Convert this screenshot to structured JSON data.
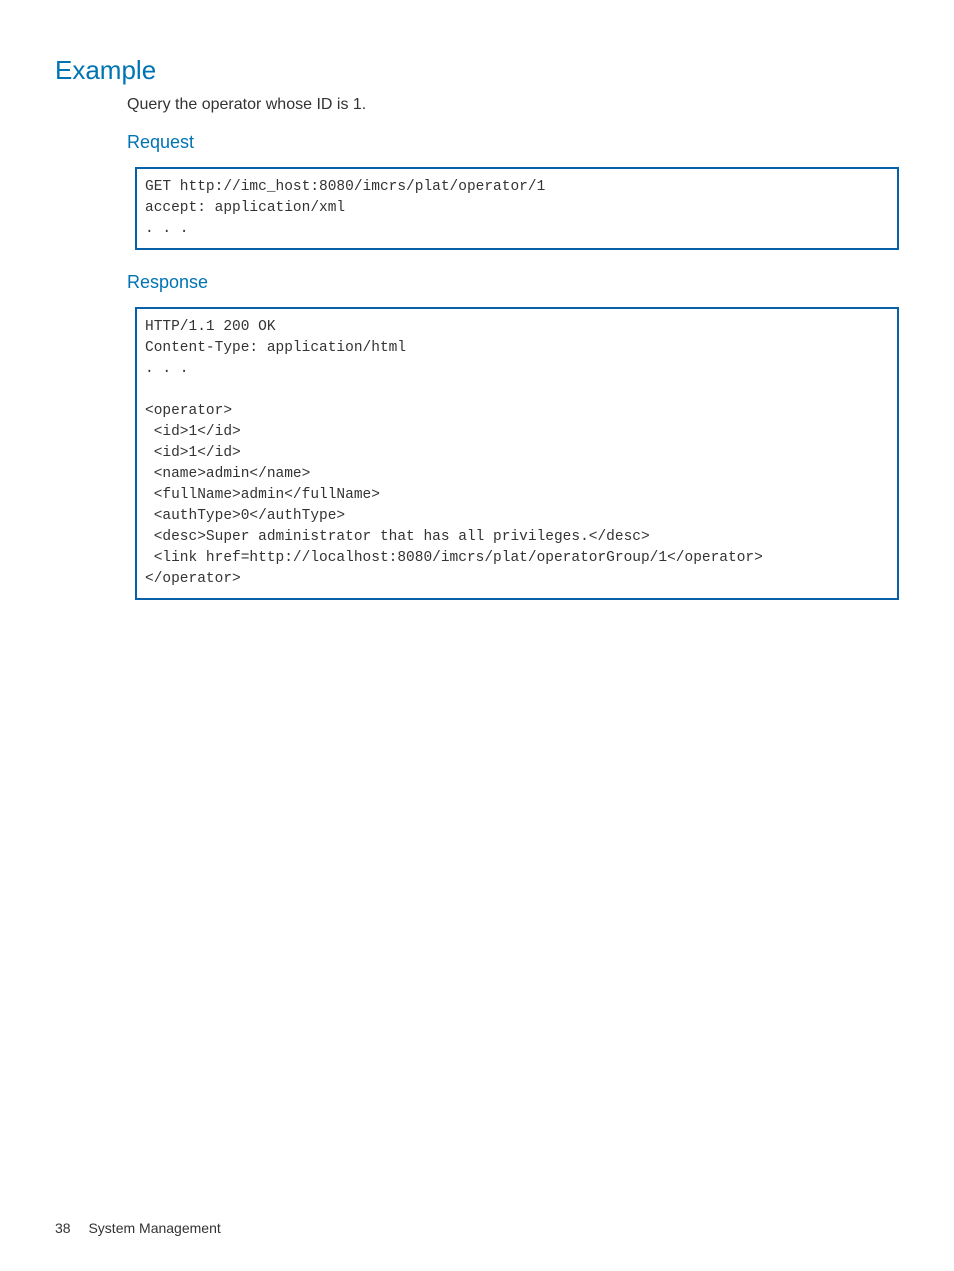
{
  "headings": {
    "example": "Example",
    "request": "Request",
    "response": "Response"
  },
  "intro": "Query the operator whose ID is 1.",
  "code": {
    "request": "GET http://imc_host:8080/imcrs/plat/operator/1\naccept: application/xml\n. . .",
    "response": "HTTP/1.1 200 OK\nContent-Type: application/html\n. . .\n\n<operator>\n <id>1</id>\n <id>1</id>\n <name>admin</name>\n <fullName>admin</fullName>\n <authType>0</authType>\n <desc>Super administrator that has all privileges.</desc>\n <link href=http://localhost:8080/imcrs/plat/operatorGroup/1</operator>\n</operator>"
  },
  "footer": {
    "page_number": "38",
    "section": "System Management"
  }
}
